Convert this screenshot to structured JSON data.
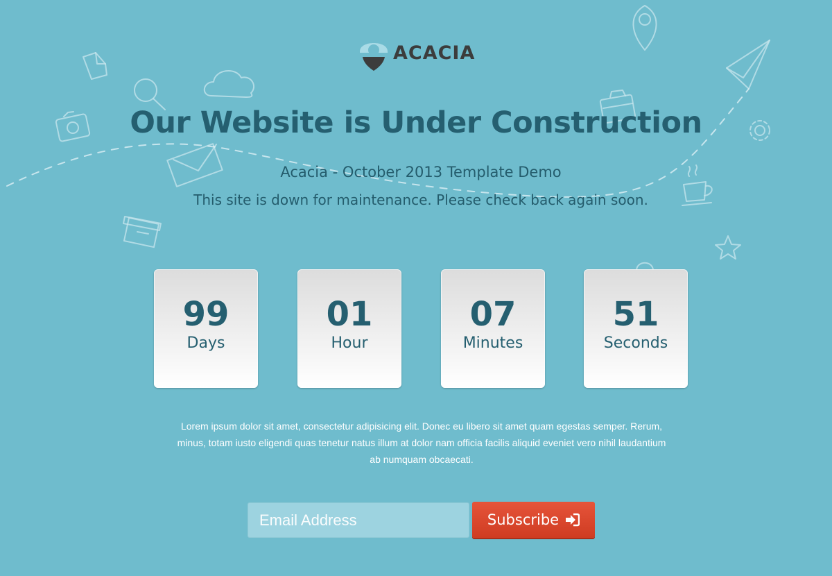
{
  "brand": {
    "name": "ACACIA"
  },
  "hero": {
    "title": "Our Website is Under Construction",
    "subtitle": "Acacia - October 2013 Template Demo",
    "notice": "This site is down for maintenance. Please check back again soon."
  },
  "countdown": [
    {
      "value": "99",
      "unit": "Days"
    },
    {
      "value": "01",
      "unit": "Hour"
    },
    {
      "value": "07",
      "unit": "Minutes"
    },
    {
      "value": "51",
      "unit": "Seconds"
    }
  ],
  "description": "Lorem ipsum dolor sit amet, consectetur adipisicing elit. Donec eu libero sit amet quam egestas semper. Rerum, minus, totam iusto eligendi quas tenetur natus illum at dolor nam officia facilis aliquid eveniet vero nihil laudantium ab numquam obcaecati.",
  "subscribe": {
    "email_placeholder": "Email Address",
    "button_label": "Subscribe",
    "button_icon": "sign-in-icon"
  },
  "colors": {
    "background": "#6fbccd",
    "heading": "#255f70",
    "button": "#dc4a30",
    "logo_accent": "#a9dbe6"
  }
}
